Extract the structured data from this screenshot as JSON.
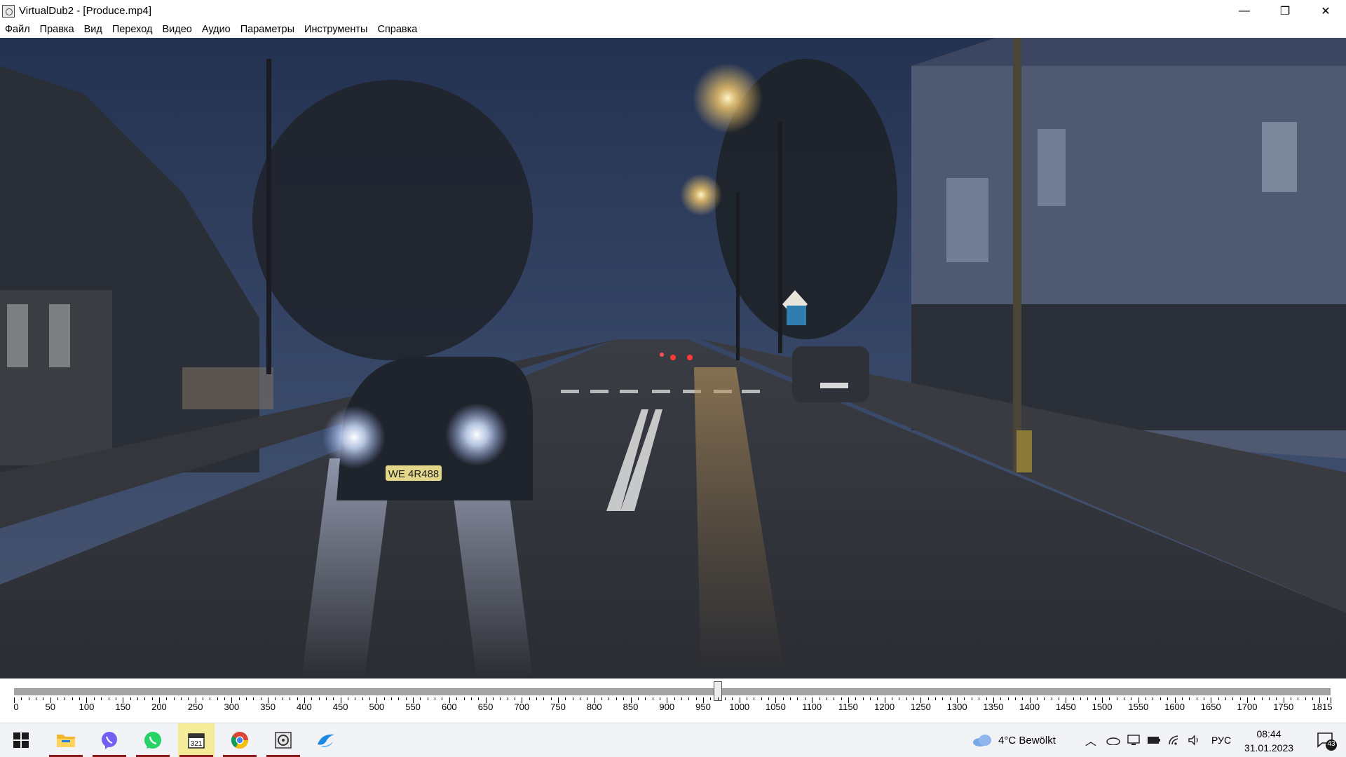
{
  "window": {
    "title": "VirtualDub2  - [Produce.mp4]",
    "minimize_symbol": "—",
    "maximize_symbol": "❐",
    "close_symbol": "✕"
  },
  "menu": [
    "Файл",
    "Правка",
    "Вид",
    "Переход",
    "Видео",
    "Аудио",
    "Параметры",
    "Инструменты",
    "Справка"
  ],
  "video": {
    "frame_description_icon": "video-frame",
    "plate_text": "WE 4R488"
  },
  "timeline": {
    "min": 0,
    "max": 1815,
    "current_frame": 970,
    "labels": [
      "0",
      "50",
      "100",
      "150",
      "200",
      "250",
      "300",
      "350",
      "400",
      "450",
      "500",
      "550",
      "600",
      "650",
      "700",
      "750",
      "800",
      "850",
      "900",
      "950",
      "1000",
      "1050",
      "1100",
      "1150",
      "1200",
      "1250",
      "1300",
      "1350",
      "1400",
      "1450",
      "1500",
      "1550",
      "1600",
      "1650",
      "1700",
      "1750",
      "1815"
    ]
  },
  "taskbar": {
    "apps": [
      {
        "name": "start",
        "icon": "windows-logo-icon"
      },
      {
        "name": "explorer",
        "icon": "folder-icon"
      },
      {
        "name": "viber",
        "icon": "viber-icon"
      },
      {
        "name": "whatsapp",
        "icon": "whatsapp-icon"
      },
      {
        "name": "calendar",
        "icon": "calendar-icon"
      },
      {
        "name": "chrome",
        "icon": "chrome-icon"
      },
      {
        "name": "virtualdub",
        "icon": "virtualdub-icon"
      },
      {
        "name": "edge",
        "icon": "edge-icon"
      }
    ],
    "weather": "4°C  Bewölkt",
    "language": "РУС",
    "time": "08:44",
    "date": "31.01.2023",
    "notifications": "43"
  },
  "colors": {
    "accent_underline": "#8b1a1a",
    "track": "#a3a3a3"
  }
}
